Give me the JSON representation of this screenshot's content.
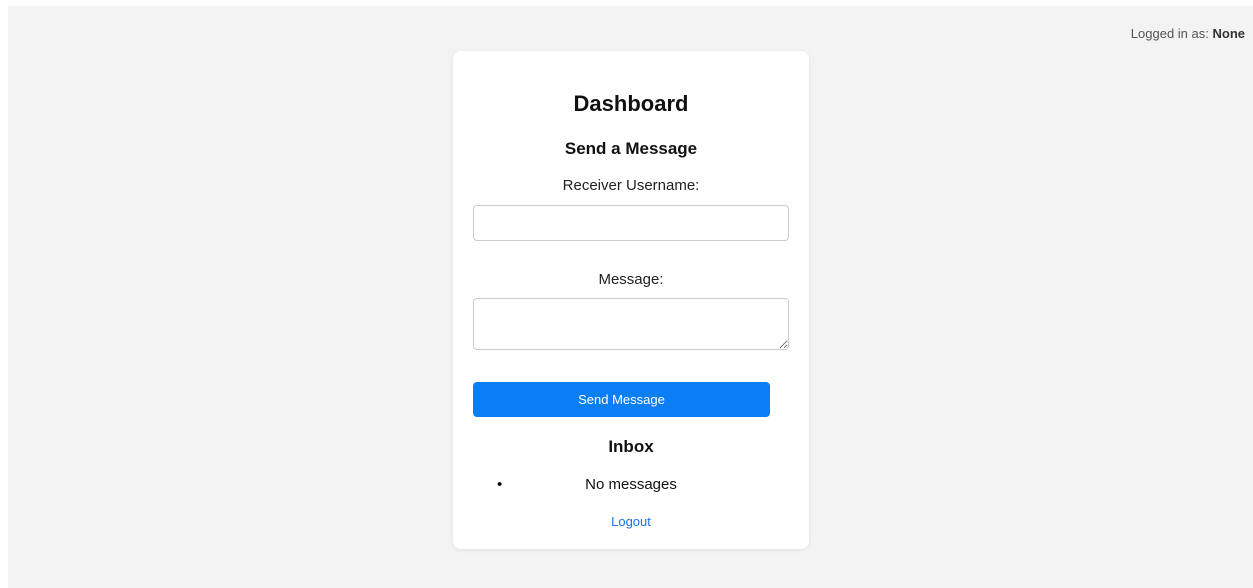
{
  "status": {
    "prefix": "Logged in as:",
    "user": "None"
  },
  "card": {
    "title": "Dashboard",
    "send_section": {
      "heading": "Send a Message",
      "receiver_label": "Receiver Username:",
      "receiver_value": "",
      "message_label": "Message:",
      "message_value": "",
      "send_button_label": "Send Message"
    },
    "inbox": {
      "heading": "Inbox",
      "items": [
        "No messages"
      ]
    },
    "logout_label": "Logout"
  },
  "colors": {
    "page_background": "#f3f3f3",
    "card_background": "#ffffff",
    "button_background": "#0a7ff5",
    "link": "#1a73e8"
  },
  "icons": {
    "inbox_bullet": "bullet-icon",
    "textarea_resize": "resize-handle-icon"
  }
}
